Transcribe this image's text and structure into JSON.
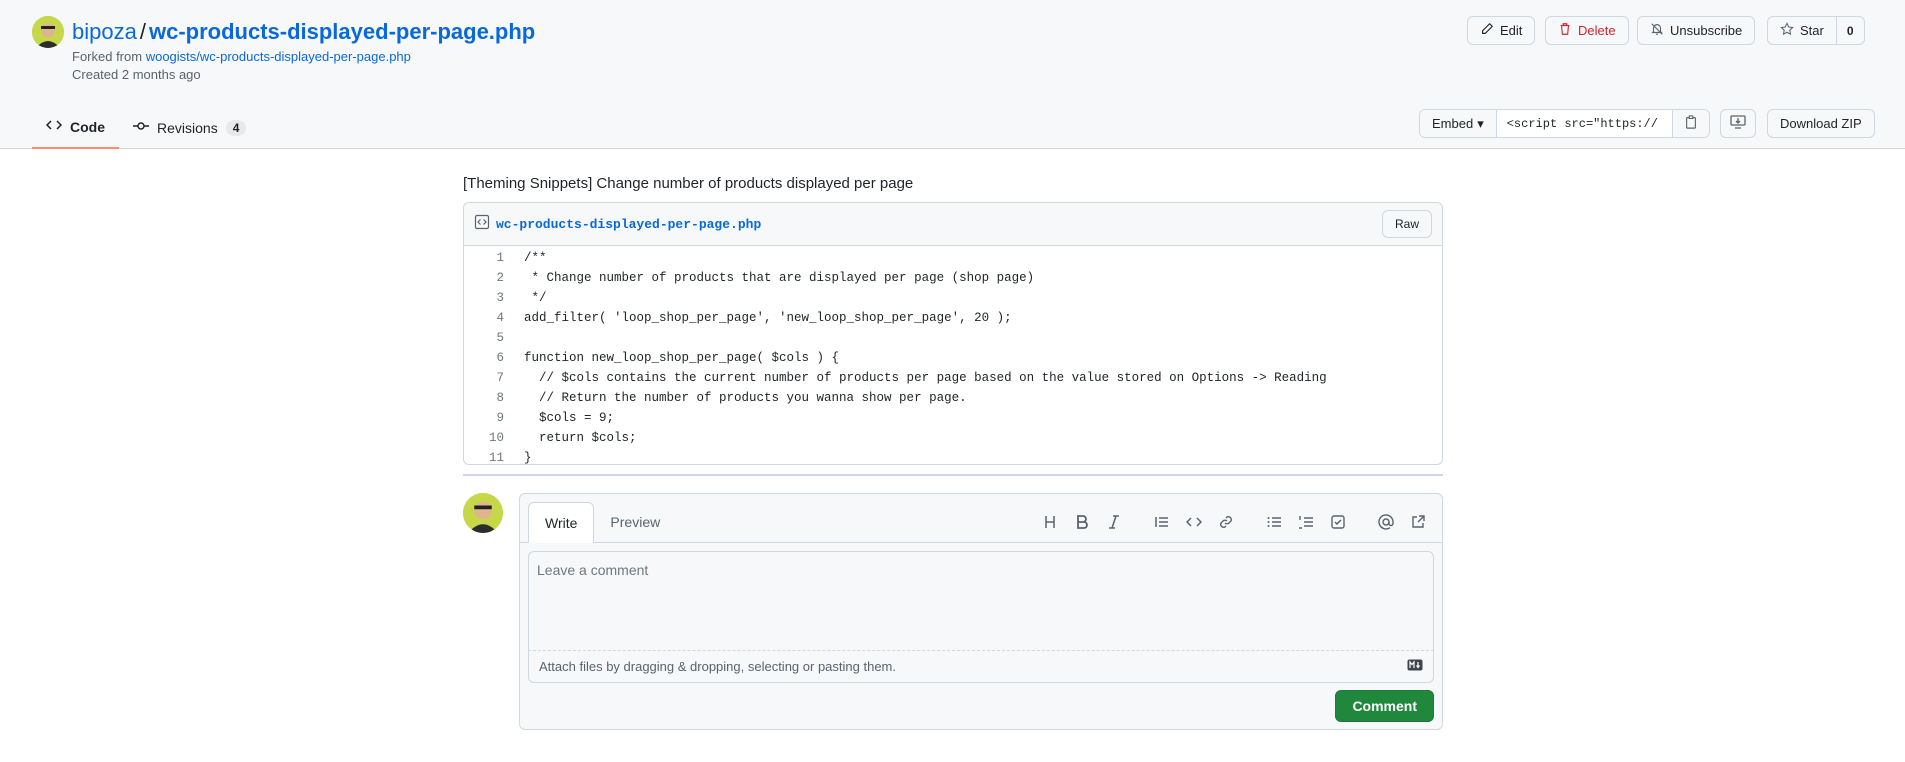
{
  "header": {
    "owner": "bipoza",
    "separator": "/",
    "gist_name": "wc-products-displayed-per-page.php",
    "forked_prefix": "Forked from",
    "forked_link": "woogists/wc-products-displayed-per-page.php",
    "created": "Created 2 months ago",
    "actions": {
      "edit": "Edit",
      "delete": "Delete",
      "unsubscribe": "Unsubscribe",
      "star": "Star",
      "star_count": "0"
    },
    "tabs": {
      "code": "Code",
      "revisions": "Revisions",
      "revisions_count": "4"
    },
    "embed": {
      "label": "Embed",
      "url": "<script src=\"https://",
      "download": "Download ZIP"
    }
  },
  "description": "[Theming Snippets] Change number of products displayed per page",
  "file": {
    "name": "wc-products-displayed-per-page.php",
    "raw_label": "Raw",
    "lines": [
      {
        "n": "1",
        "code": "/**"
      },
      {
        "n": "2",
        "code": " * Change number of products that are displayed per page (shop page)"
      },
      {
        "n": "3",
        "code": " */"
      },
      {
        "n": "4",
        "code": "add_filter( 'loop_shop_per_page', 'new_loop_shop_per_page', 20 );"
      },
      {
        "n": "5",
        "code": ""
      },
      {
        "n": "6",
        "code": "function new_loop_shop_per_page( $cols ) {"
      },
      {
        "n": "7",
        "code": "  // $cols contains the current number of products per page based on the value stored on Options -> Reading"
      },
      {
        "n": "8",
        "code": "  // Return the number of products you wanna show per page."
      },
      {
        "n": "9",
        "code": "  $cols = 9;"
      },
      {
        "n": "10",
        "code": "  return $cols;"
      },
      {
        "n": "11",
        "code": "}"
      }
    ]
  },
  "comment": {
    "tab_write": "Write",
    "tab_preview": "Preview",
    "placeholder": "Leave a comment",
    "attach_text": "Attach files by dragging & dropping, selecting or pasting them.",
    "submit": "Comment"
  },
  "colors": {
    "link": "#0969da",
    "danger": "#d1242f",
    "primary": "#1f883d",
    "active_tab": "#fd8c73"
  }
}
